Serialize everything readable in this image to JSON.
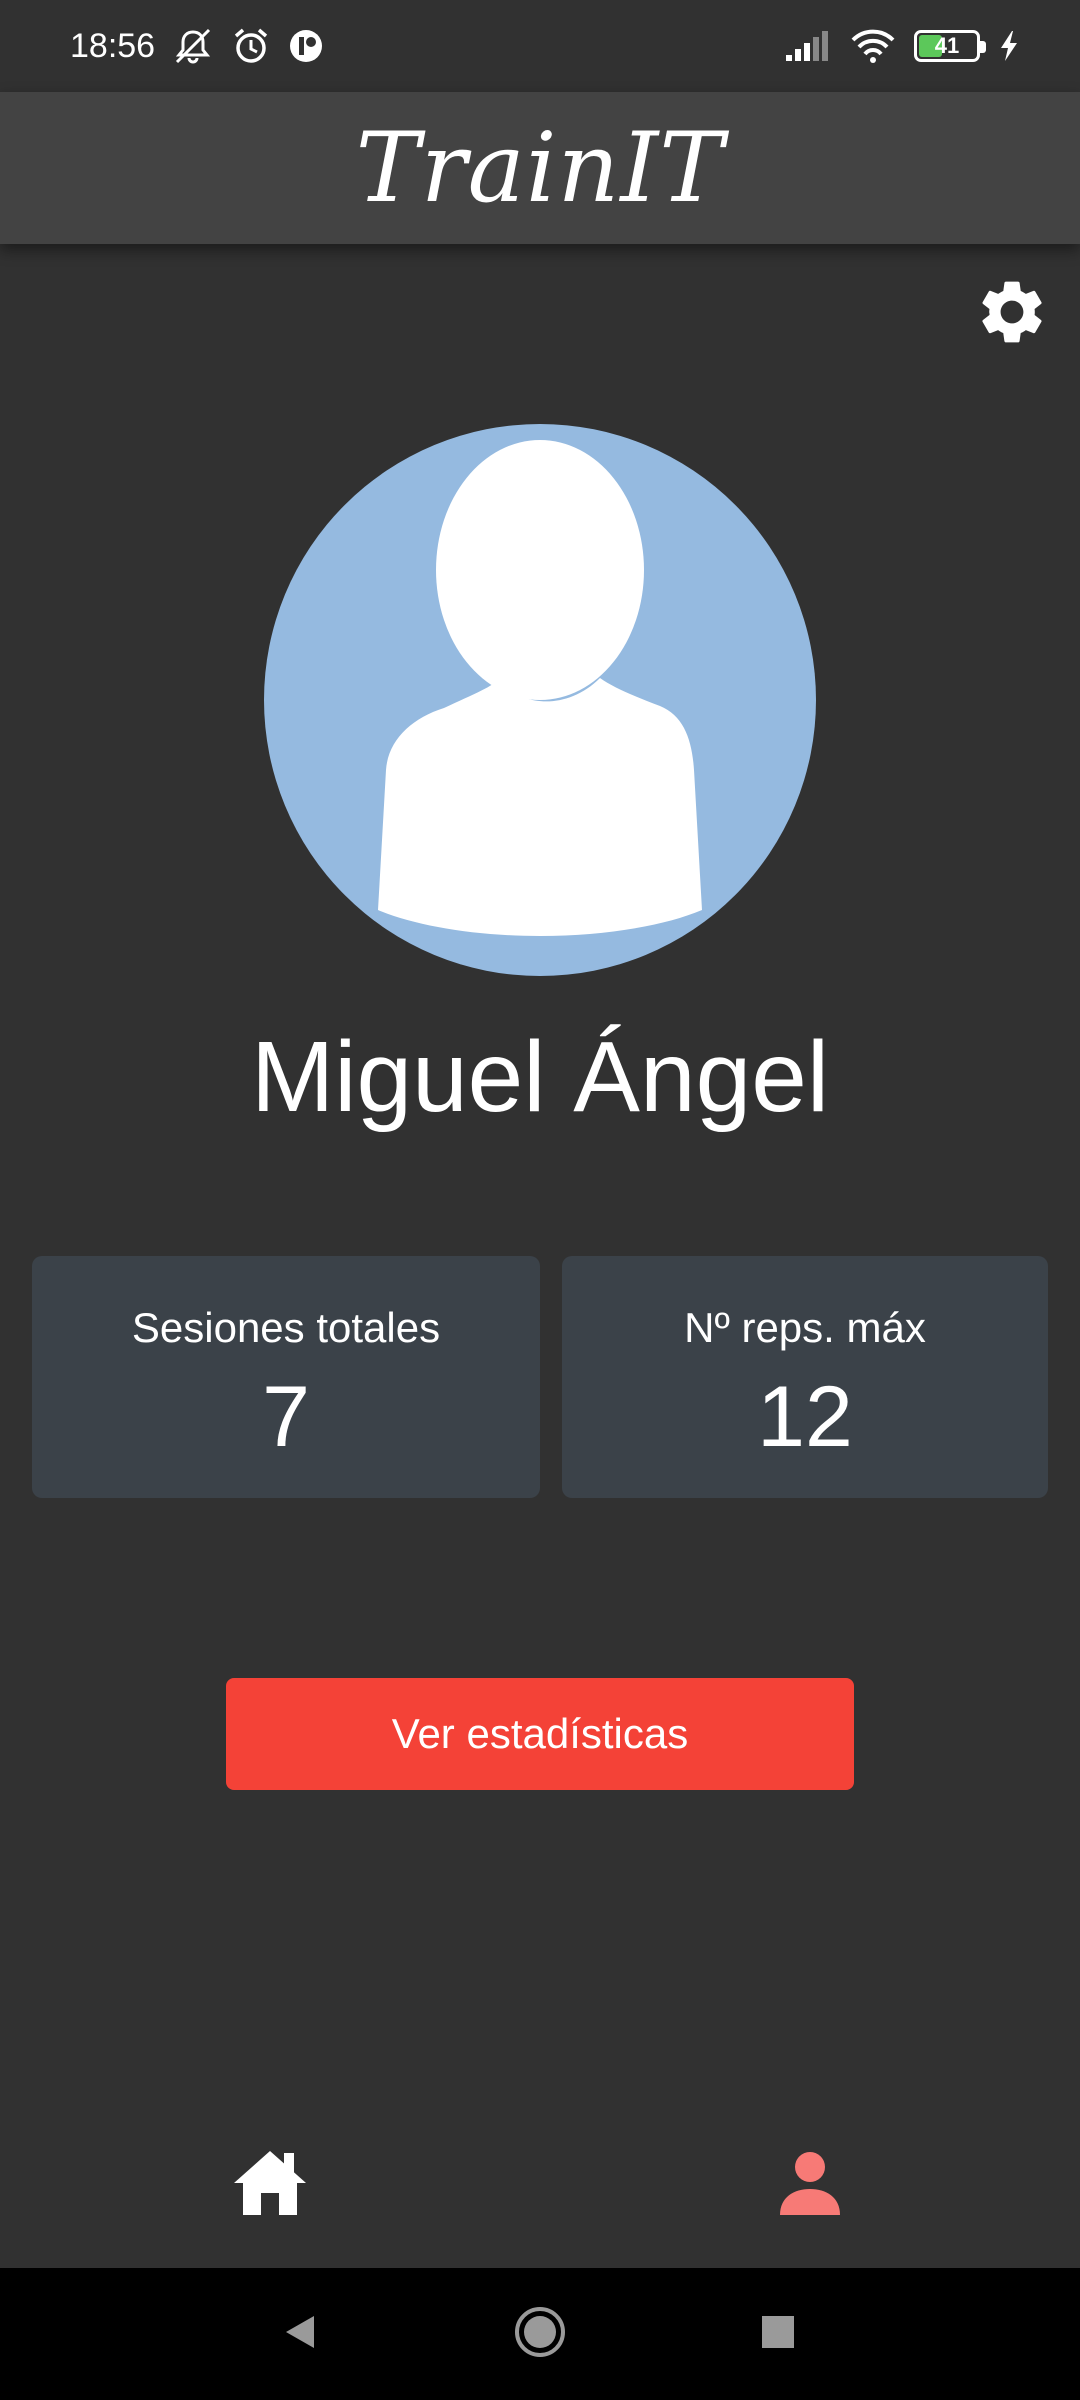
{
  "status_bar": {
    "time": "18:56",
    "battery_level": "41",
    "battery_fraction": 0.41,
    "icons": [
      "notifications-off-icon",
      "alarm-icon",
      "app-notification-icon",
      "signal-icon",
      "wifi-icon",
      "battery-icon",
      "charging-icon"
    ]
  },
  "app_bar": {
    "title": "TrainIT"
  },
  "profile": {
    "name": "Miguel Ángel",
    "avatar_icon": "default-user-avatar"
  },
  "stats": [
    {
      "label": "Sesiones totales",
      "value": "7"
    },
    {
      "label": "Nº reps. máx",
      "value": "12"
    }
  ],
  "actions": {
    "stats_button_label": "Ver estadísticas"
  },
  "bottom_nav": {
    "items": [
      {
        "icon": "home-icon",
        "active": false
      },
      {
        "icon": "person-icon",
        "active": true
      }
    ]
  },
  "colors": {
    "background": "#313131",
    "app_bar": "#434343",
    "card": "#3b4249",
    "accent": "#f44237",
    "avatar_bg": "#95bae0",
    "active_nav": "#f77a76"
  }
}
